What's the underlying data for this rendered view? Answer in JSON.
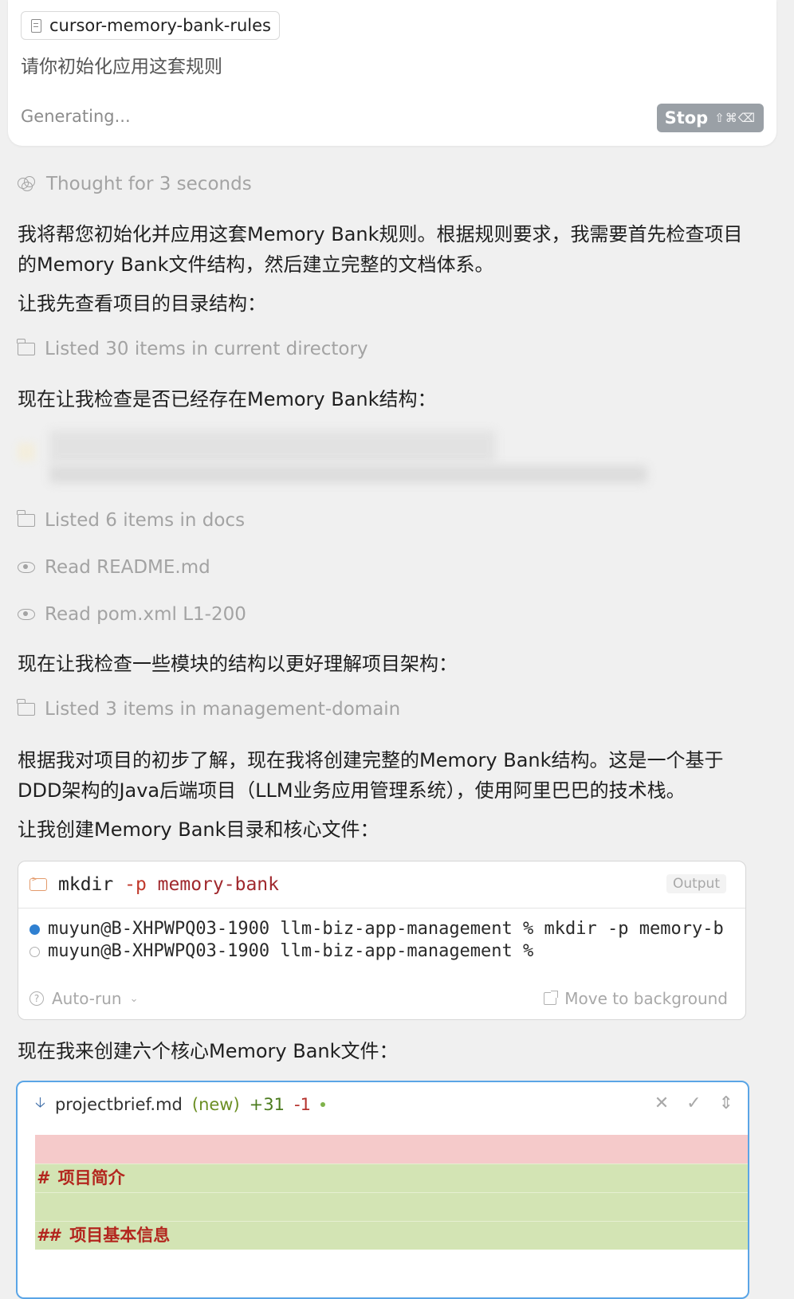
{
  "prompt_card": {
    "rule_chip": "cursor-memory-bank-rules",
    "prompt": "请你初始化应用这套规则",
    "status": "Generating...",
    "stop_label": "Stop",
    "stop_shortcut": "⇧⌘⌫"
  },
  "thought": "Thought for 3 seconds",
  "para1": "我将帮您初始化并应用这套Memory Bank规则。根据规则要求，我需要首先检查项目的Memory Bank文件结构，然后建立完整的文档体系。",
  "para2": "让我先查看项目的目录结构：",
  "step1": "Listed 30 items in current directory",
  "para3": "现在让我检查是否已经存在Memory Bank结构：",
  "step2": "Listed 6 items in docs",
  "step3": "Read README.md",
  "step4": "Read pom.xml L1-200",
  "para4": "现在让我检查一些模块的结构以更好理解项目架构：",
  "step5": "Listed 3 items in management-domain",
  "para5": "根据我对项目的初步了解，现在我将创建完整的Memory Bank结构。这是一个基于DDD架构的Java后端项目（LLM业务应用管理系统），使用阿里巴巴的技术栈。",
  "para6": "让我创建Memory Bank目录和核心文件：",
  "terminal": {
    "cmd": "mkdir",
    "flag": "-p",
    "arg": "memory-bank",
    "output_label": "Output",
    "line1": "muyun@B-XHPWPQ03-1900 llm-biz-app-management % mkdir -p memory-b",
    "line2": "muyun@B-XHPWPQ03-1900 llm-biz-app-management %",
    "autorun_label": "Auto-run",
    "background_label": "Move to background"
  },
  "para7": "现在我来创建六个核心Memory Bank文件：",
  "diff": {
    "filename": "projectbrief.md",
    "new_tag": "(new)",
    "added": "+31",
    "removed": "-1",
    "line1_hash": "#",
    "line1_text": "项目简介",
    "line2_hash": "##",
    "line2_text": "项目基本信息"
  }
}
